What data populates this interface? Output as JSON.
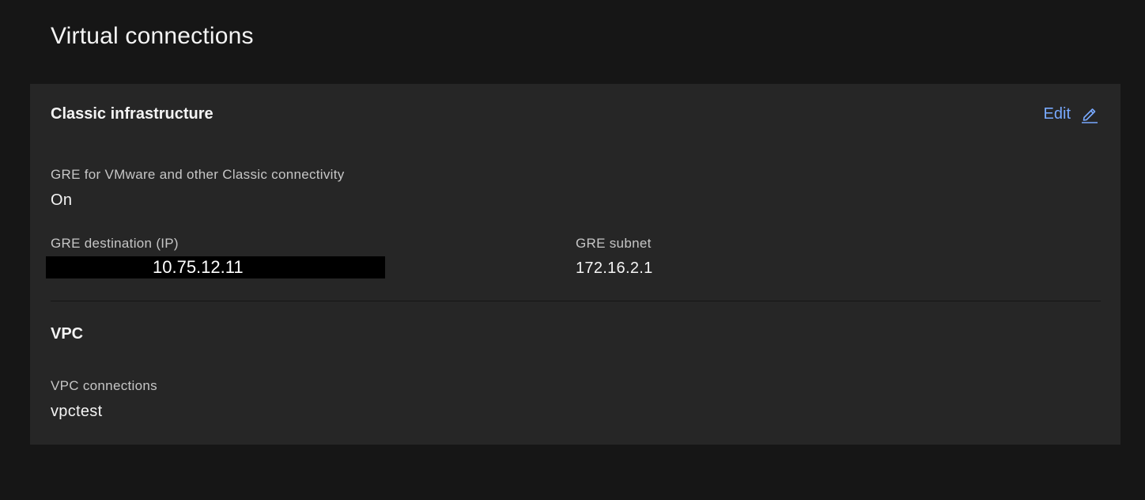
{
  "page": {
    "title": "Virtual connections"
  },
  "classic": {
    "title": "Classic infrastructure",
    "edit_label": "Edit",
    "edit_icon": "pencil-icon",
    "accent_color": "#78a9ff",
    "gre_label": "GRE for VMware and other Classic connectivity",
    "gre_value": "On",
    "destination_label": "GRE destination (IP)",
    "destination_value": "10.75.12.11",
    "subnet_label": "GRE subnet",
    "subnet_value": "172.16.2.1"
  },
  "vpc": {
    "title": "VPC",
    "connections_label": "VPC connections",
    "connections_value": "vpctest"
  }
}
